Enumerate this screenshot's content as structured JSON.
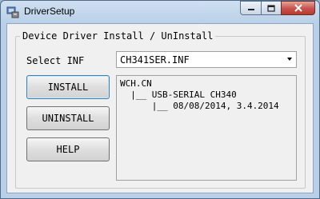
{
  "window": {
    "title": "DriverSetup",
    "icon": "driver-setup-app-icon",
    "controls": [
      "minimize-icon",
      "maximize-icon",
      "close-icon"
    ]
  },
  "group": {
    "title": "Device Driver Install / UnInstall"
  },
  "inf": {
    "label": "Select INF",
    "selected": "CH341SER.INF"
  },
  "buttons": {
    "install": "INSTALL",
    "uninstall": "UNINSTALL",
    "help": "HELP"
  },
  "info_panel": {
    "lines": [
      "WCH.CN",
      "  |__ USB-SERIAL CH340",
      "      |__ 08/08/2014, 3.4.2014"
    ]
  }
}
